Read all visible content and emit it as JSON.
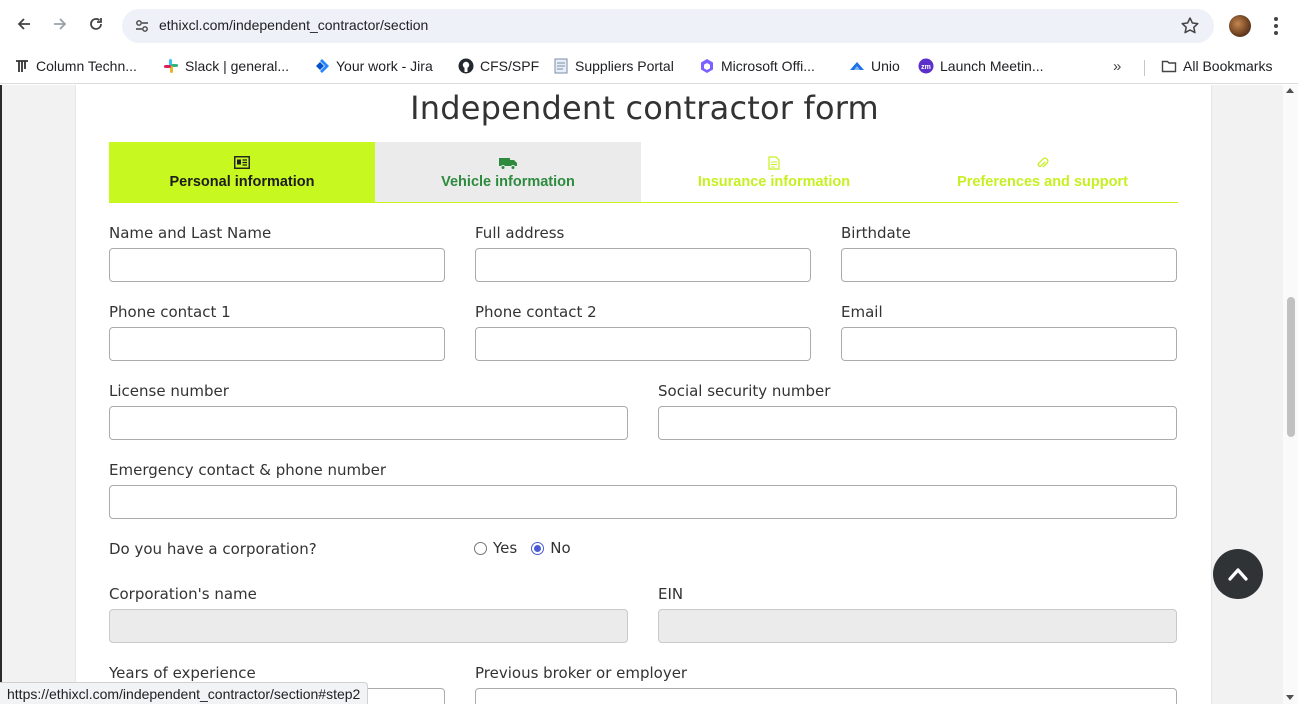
{
  "browser": {
    "url": "ethixcl.com/independent_contractor/section",
    "status_url": "https://ethixcl.com/independent_contractor/section#step2",
    "bookmarks": [
      {
        "label": "Column Techn...",
        "icon": "column-logo-icon"
      },
      {
        "label": "Slack | general...",
        "icon": "slack-logo-icon"
      },
      {
        "label": "Your work - Jira",
        "icon": "jira-logo-icon"
      },
      {
        "label": "CFS/SPF",
        "icon": "github-logo-icon"
      },
      {
        "label": "Suppliers Portal",
        "icon": "document-icon"
      },
      {
        "label": "Microsoft Offi...",
        "icon": "microsoft-office-icon"
      },
      {
        "label": "Unio",
        "icon": "unio-logo-icon"
      },
      {
        "label": "Launch Meetin...",
        "icon": "zoom-logo-icon"
      }
    ],
    "all_bookmarks_label": "All Bookmarks",
    "more_label": "»"
  },
  "form": {
    "title": "Independent contractor form",
    "steps": [
      {
        "label": "Personal information",
        "icon": "id-card-icon",
        "state": "active"
      },
      {
        "label": "Vehicle information",
        "icon": "truck-icon",
        "state": "next"
      },
      {
        "label": "Insurance information",
        "icon": "file-icon",
        "state": "future"
      },
      {
        "label": "Preferences and support",
        "icon": "paperclip-icon",
        "state": "future"
      }
    ],
    "fields": {
      "name": {
        "label": "Name and Last Name",
        "value": ""
      },
      "address": {
        "label": "Full address",
        "value": ""
      },
      "birthdate": {
        "label": "Birthdate",
        "value": ""
      },
      "phone1": {
        "label": "Phone contact 1",
        "value": ""
      },
      "phone2": {
        "label": "Phone contact 2",
        "value": ""
      },
      "email": {
        "label": "Email",
        "value": ""
      },
      "license": {
        "label": "License number",
        "value": ""
      },
      "ssn": {
        "label": "Social security number",
        "value": ""
      },
      "emergency": {
        "label": "Emergency contact & phone number",
        "value": ""
      },
      "corp_name": {
        "label": "Corporation's name",
        "value": "",
        "disabled": true
      },
      "ein": {
        "label": "EIN",
        "value": "",
        "disabled": true
      },
      "years": {
        "label": "Years of experience",
        "value": ""
      },
      "previous": {
        "label": "Previous broker or employer",
        "value": ""
      }
    },
    "corporation_question": {
      "label": "Do you have a corporation?",
      "options": [
        "Yes",
        "No"
      ],
      "selected": "No"
    }
  },
  "colors": {
    "accent_lime": "#c7f81f",
    "step_green_text": "#2e8b3e",
    "future_step_text": "#c7f022",
    "radio_selected": "#4a5bd4"
  }
}
